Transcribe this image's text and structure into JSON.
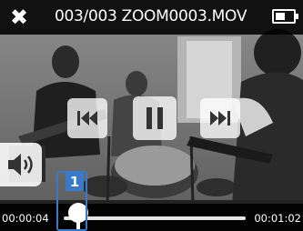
{
  "header": {
    "title": "003/003 ZOOM0003.MOV",
    "battery_icon": "battery-icon"
  },
  "controls": {
    "close_icon": "close-icon",
    "previous_icon": "skip-previous-icon",
    "pause_icon": "pause-icon",
    "next_icon": "skip-next-icon",
    "volume_icon": "volume-icon"
  },
  "playback": {
    "elapsed": "00:00:04",
    "total": "00:01:02",
    "progress": 0.06
  },
  "annotation": {
    "label": "1",
    "color": "#3a78c9"
  }
}
